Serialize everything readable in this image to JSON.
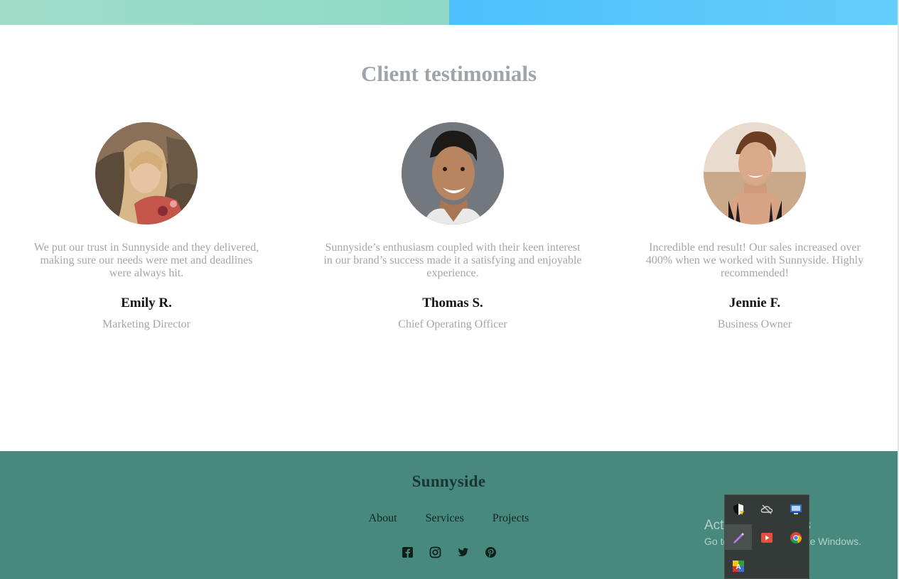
{
  "section": {
    "title": "Client testimonials"
  },
  "testimonials": [
    {
      "quote": "We put our trust in Sunnyside and they delivered, making sure our needs were met and deadlines were always hit.",
      "name": "Emily R.",
      "role": "Marketing Director"
    },
    {
      "quote": "Sunnyside’s enthusiasm coupled with their keen interest in our brand’s success made it a satisfying and enjoyable experience.",
      "name": "Thomas S.",
      "role": "Chief Operating Officer"
    },
    {
      "quote": "Incredible end result! Our sales increased over 400% when we worked with Sunnyside. Highly recommended!",
      "name": "Jennie F.",
      "role": "Business Owner"
    }
  ],
  "footer": {
    "brand": "Sunnyside",
    "nav": [
      "About",
      "Services",
      "Projects"
    ],
    "socials": [
      "facebook-icon",
      "instagram-icon",
      "twitter-icon",
      "pinterest-icon"
    ]
  },
  "os_overlay": {
    "activate_title": "Activate Windows",
    "activate_sub": "Go to Settings to activate Windows.",
    "tray_icons": [
      "security-shield-icon",
      "cloud-offline-icon",
      "display-icon",
      "pen-icon",
      "media-icon",
      "chrome-icon",
      "language-icon"
    ]
  },
  "colors": {
    "footer_bg": "#478a7d",
    "title_gray": "#9ea5aa",
    "text_gray": "#a3a6a8",
    "strip_green": "#9fdcc8",
    "strip_blue": "#4dc0fb"
  }
}
